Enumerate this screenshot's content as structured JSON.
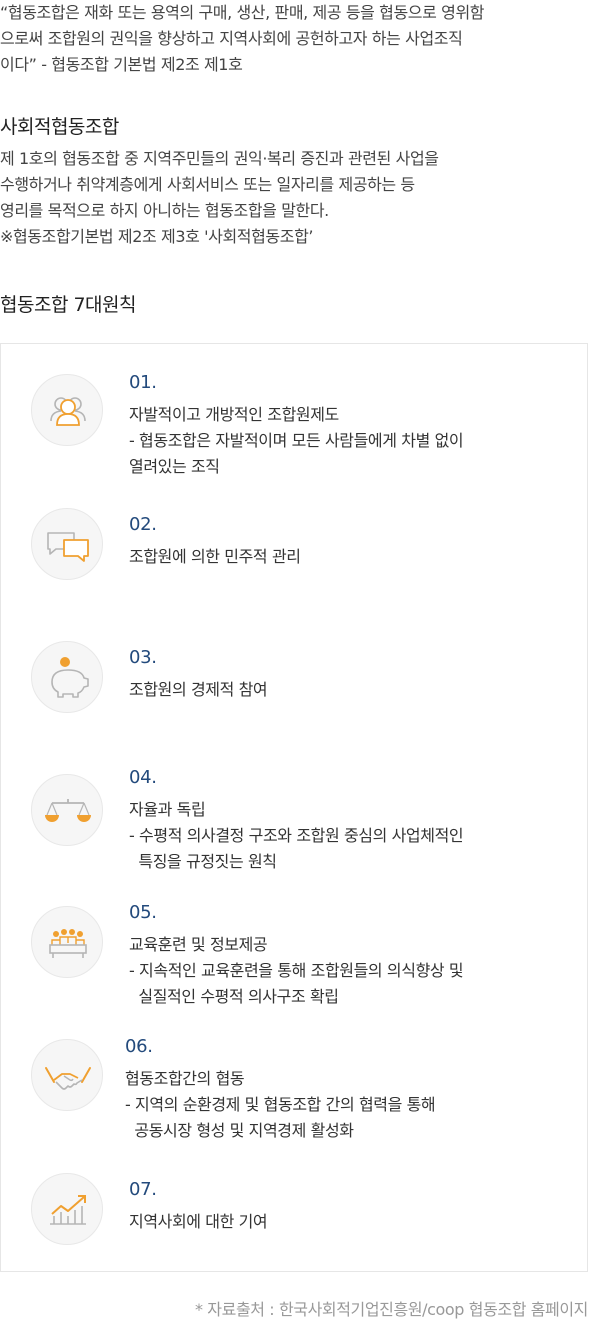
{
  "intro": {
    "lines": [
      "“협동조합은 재화 또는 용역의 구매, 생산, 판매, 제공 등을 협동으로 영위함",
      "으로써 조합원의 권익을 향상하고 지역사회에 공헌하고자 하는 사업조직",
      "이다” - 협동조합 기본법 제2조 제1호"
    ]
  },
  "social": {
    "title": "사회적협동조합",
    "lines": [
      "제 1호의 협동조합 중 지역주민들의 권익·복리 증진과 관련된 사업을",
      "수행하거나 취약계층에게 사회서비스 또는 일자리를 제공하는 등",
      "영리를 목적으로 하지 아니하는 협동조합을 말한다.",
      "※협동조합기본법 제2조 제3호 '사회적협동조합’"
    ]
  },
  "principles": {
    "title": "협동조합 7대원칙",
    "items": [
      {
        "num": "01.",
        "icon": "people-icon",
        "lines": [
          "자발적이고 개방적인 조합원제도",
          "- 협동조합은 자발적이며 모든 사람들에게 차별 없이",
          "열려있는 조직"
        ]
      },
      {
        "num": "02.",
        "icon": "chat-icon",
        "lines": [
          "조합원에 의한 민주적 관리"
        ]
      },
      {
        "num": "03.",
        "icon": "piggy-bank-icon",
        "lines": [
          "조합원의 경제적 참여"
        ]
      },
      {
        "num": "04.",
        "icon": "scale-icon",
        "lines": [
          "자율과 독립",
          "- 수평적 의사결정 구조와 조합원 중심의 사업체적인",
          "  특징을 규정짓는 원칙"
        ]
      },
      {
        "num": "05.",
        "icon": "education-icon",
        "lines": [
          "교육훈련 및 정보제공",
          "- 지속적인 교육훈련을 통해 조합원들의 의식향상 및",
          "  실질적인 수평적 의사구조 확립"
        ]
      },
      {
        "num": "06.",
        "icon": "handshake-icon",
        "lines": [
          "협동조합간의 협동",
          "- 지역의 순환경제 및 협동조합 간의 협력을 통해",
          "  공동시장 형성 및 지역경제 활성화"
        ]
      },
      {
        "num": "07.",
        "icon": "growth-chart-icon",
        "lines": [
          "지역사회에 대한 기여"
        ]
      }
    ]
  },
  "source": "* 자료출처 : 한국사회적기업진흥원/coop 협동조합 홈페이지",
  "colors": {
    "accent_orange": "#f0a030",
    "number_blue": "#234a7c",
    "icon_gray": "#b5b5b5"
  }
}
